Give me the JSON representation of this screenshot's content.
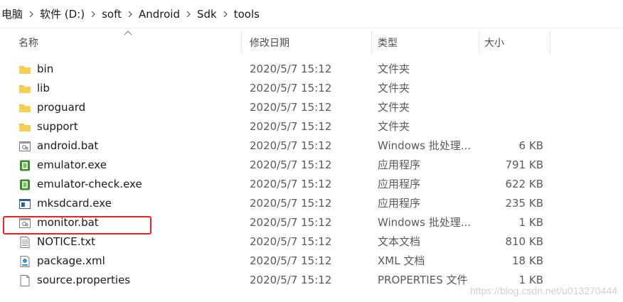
{
  "breadcrumb": [
    "电脑",
    "软件 (D:)",
    "soft",
    "Android",
    "Sdk",
    "tools"
  ],
  "columns": {
    "name": "名称",
    "date": "修改日期",
    "type": "类型",
    "size": "大小"
  },
  "files": [
    {
      "name": "bin",
      "date": "2020/5/7 15:12",
      "type": "文件夹",
      "size": "",
      "icon": "folder-icon"
    },
    {
      "name": "lib",
      "date": "2020/5/7 15:12",
      "type": "文件夹",
      "size": "",
      "icon": "folder-icon"
    },
    {
      "name": "proguard",
      "date": "2020/5/7 15:12",
      "type": "文件夹",
      "size": "",
      "icon": "folder-icon"
    },
    {
      "name": "support",
      "date": "2020/5/7 15:12",
      "type": "文件夹",
      "size": "",
      "icon": "folder-icon"
    },
    {
      "name": "android.bat",
      "date": "2020/5/7 15:12",
      "type": "Windows 批处理...",
      "size": "6 KB",
      "icon": "batch-file-icon"
    },
    {
      "name": "emulator.exe",
      "date": "2020/5/7 15:12",
      "type": "应用程序",
      "size": "791 KB",
      "icon": "exe-icon"
    },
    {
      "name": "emulator-check.exe",
      "date": "2020/5/7 15:12",
      "type": "应用程序",
      "size": "622 KB",
      "icon": "exe-icon"
    },
    {
      "name": "mksdcard.exe",
      "date": "2020/5/7 15:12",
      "type": "应用程序",
      "size": "235 KB",
      "icon": "window-app-icon"
    },
    {
      "name": "monitor.bat",
      "date": "2020/5/7 15:12",
      "type": "Windows 批处理...",
      "size": "1 KB",
      "icon": "batch-file-icon"
    },
    {
      "name": "NOTICE.txt",
      "date": "2020/5/7 15:12",
      "type": "文本文档",
      "size": "810 KB",
      "icon": "text-file-icon"
    },
    {
      "name": "package.xml",
      "date": "2020/5/7 15:12",
      "type": "XML 文档",
      "size": "18 KB",
      "icon": "xml-file-icon"
    },
    {
      "name": "source.properties",
      "date": "2020/5/7 15:12",
      "type": "PROPERTIES 文件",
      "size": "1 KB",
      "icon": "blank-file-icon"
    }
  ],
  "highlighted_file": "monitor.bat",
  "watermark": "https://blog.csdn.net/u013270444",
  "colors": {
    "folder": "#f5c342",
    "highlight": "#f02020",
    "exe_green": "#3a8f2a"
  }
}
